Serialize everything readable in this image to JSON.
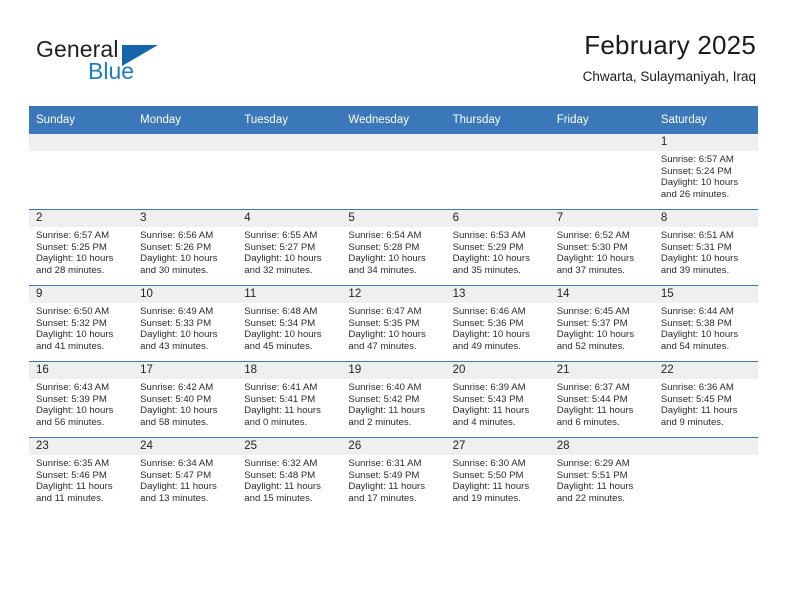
{
  "brand": {
    "name_part1": "General",
    "name_part2": "Blue",
    "triangle_color": "#1565ab",
    "blue_color": "#1f7dc2"
  },
  "header": {
    "title": "February 2025",
    "subtitle": "Chwarta, Sulaymaniyah, Iraq"
  },
  "theme": {
    "header_blue": "#3b78b9",
    "daynum_band": "#efefef",
    "text": "#2b2b2b"
  },
  "weekday_headers": [
    "Sunday",
    "Monday",
    "Tuesday",
    "Wednesday",
    "Thursday",
    "Friday",
    "Saturday"
  ],
  "labels": {
    "sunrise_prefix": "Sunrise:",
    "sunset_prefix": "Sunset:",
    "daylight_prefix": "Daylight:"
  },
  "weeks": [
    [
      {
        "day": "",
        "sunrise": "",
        "sunset": "",
        "daylight_a": "",
        "daylight_b": "",
        "empty": true
      },
      {
        "day": "",
        "sunrise": "",
        "sunset": "",
        "daylight_a": "",
        "daylight_b": "",
        "empty": true
      },
      {
        "day": "",
        "sunrise": "",
        "sunset": "",
        "daylight_a": "",
        "daylight_b": "",
        "empty": true
      },
      {
        "day": "",
        "sunrise": "",
        "sunset": "",
        "daylight_a": "",
        "daylight_b": "",
        "empty": true
      },
      {
        "day": "",
        "sunrise": "",
        "sunset": "",
        "daylight_a": "",
        "daylight_b": "",
        "empty": true
      },
      {
        "day": "",
        "sunrise": "",
        "sunset": "",
        "daylight_a": "",
        "daylight_b": "",
        "empty": true
      },
      {
        "day": "1",
        "sunrise": "Sunrise: 6:57 AM",
        "sunset": "Sunset: 5:24 PM",
        "daylight_a": "Daylight: 10 hours",
        "daylight_b": "and 26 minutes.",
        "empty": false
      }
    ],
    [
      {
        "day": "2",
        "sunrise": "Sunrise: 6:57 AM",
        "sunset": "Sunset: 5:25 PM",
        "daylight_a": "Daylight: 10 hours",
        "daylight_b": "and 28 minutes.",
        "empty": false
      },
      {
        "day": "3",
        "sunrise": "Sunrise: 6:56 AM",
        "sunset": "Sunset: 5:26 PM",
        "daylight_a": "Daylight: 10 hours",
        "daylight_b": "and 30 minutes.",
        "empty": false
      },
      {
        "day": "4",
        "sunrise": "Sunrise: 6:55 AM",
        "sunset": "Sunset: 5:27 PM",
        "daylight_a": "Daylight: 10 hours",
        "daylight_b": "and 32 minutes.",
        "empty": false
      },
      {
        "day": "5",
        "sunrise": "Sunrise: 6:54 AM",
        "sunset": "Sunset: 5:28 PM",
        "daylight_a": "Daylight: 10 hours",
        "daylight_b": "and 34 minutes.",
        "empty": false
      },
      {
        "day": "6",
        "sunrise": "Sunrise: 6:53 AM",
        "sunset": "Sunset: 5:29 PM",
        "daylight_a": "Daylight: 10 hours",
        "daylight_b": "and 35 minutes.",
        "empty": false
      },
      {
        "day": "7",
        "sunrise": "Sunrise: 6:52 AM",
        "sunset": "Sunset: 5:30 PM",
        "daylight_a": "Daylight: 10 hours",
        "daylight_b": "and 37 minutes.",
        "empty": false
      },
      {
        "day": "8",
        "sunrise": "Sunrise: 6:51 AM",
        "sunset": "Sunset: 5:31 PM",
        "daylight_a": "Daylight: 10 hours",
        "daylight_b": "and 39 minutes.",
        "empty": false
      }
    ],
    [
      {
        "day": "9",
        "sunrise": "Sunrise: 6:50 AM",
        "sunset": "Sunset: 5:32 PM",
        "daylight_a": "Daylight: 10 hours",
        "daylight_b": "and 41 minutes.",
        "empty": false
      },
      {
        "day": "10",
        "sunrise": "Sunrise: 6:49 AM",
        "sunset": "Sunset: 5:33 PM",
        "daylight_a": "Daylight: 10 hours",
        "daylight_b": "and 43 minutes.",
        "empty": false
      },
      {
        "day": "11",
        "sunrise": "Sunrise: 6:48 AM",
        "sunset": "Sunset: 5:34 PM",
        "daylight_a": "Daylight: 10 hours",
        "daylight_b": "and 45 minutes.",
        "empty": false
      },
      {
        "day": "12",
        "sunrise": "Sunrise: 6:47 AM",
        "sunset": "Sunset: 5:35 PM",
        "daylight_a": "Daylight: 10 hours",
        "daylight_b": "and 47 minutes.",
        "empty": false
      },
      {
        "day": "13",
        "sunrise": "Sunrise: 6:46 AM",
        "sunset": "Sunset: 5:36 PM",
        "daylight_a": "Daylight: 10 hours",
        "daylight_b": "and 49 minutes.",
        "empty": false
      },
      {
        "day": "14",
        "sunrise": "Sunrise: 6:45 AM",
        "sunset": "Sunset: 5:37 PM",
        "daylight_a": "Daylight: 10 hours",
        "daylight_b": "and 52 minutes.",
        "empty": false
      },
      {
        "day": "15",
        "sunrise": "Sunrise: 6:44 AM",
        "sunset": "Sunset: 5:38 PM",
        "daylight_a": "Daylight: 10 hours",
        "daylight_b": "and 54 minutes.",
        "empty": false
      }
    ],
    [
      {
        "day": "16",
        "sunrise": "Sunrise: 6:43 AM",
        "sunset": "Sunset: 5:39 PM",
        "daylight_a": "Daylight: 10 hours",
        "daylight_b": "and 56 minutes.",
        "empty": false
      },
      {
        "day": "17",
        "sunrise": "Sunrise: 6:42 AM",
        "sunset": "Sunset: 5:40 PM",
        "daylight_a": "Daylight: 10 hours",
        "daylight_b": "and 58 minutes.",
        "empty": false
      },
      {
        "day": "18",
        "sunrise": "Sunrise: 6:41 AM",
        "sunset": "Sunset: 5:41 PM",
        "daylight_a": "Daylight: 11 hours",
        "daylight_b": "and 0 minutes.",
        "empty": false
      },
      {
        "day": "19",
        "sunrise": "Sunrise: 6:40 AM",
        "sunset": "Sunset: 5:42 PM",
        "daylight_a": "Daylight: 11 hours",
        "daylight_b": "and 2 minutes.",
        "empty": false
      },
      {
        "day": "20",
        "sunrise": "Sunrise: 6:39 AM",
        "sunset": "Sunset: 5:43 PM",
        "daylight_a": "Daylight: 11 hours",
        "daylight_b": "and 4 minutes.",
        "empty": false
      },
      {
        "day": "21",
        "sunrise": "Sunrise: 6:37 AM",
        "sunset": "Sunset: 5:44 PM",
        "daylight_a": "Daylight: 11 hours",
        "daylight_b": "and 6 minutes.",
        "empty": false
      },
      {
        "day": "22",
        "sunrise": "Sunrise: 6:36 AM",
        "sunset": "Sunset: 5:45 PM",
        "daylight_a": "Daylight: 11 hours",
        "daylight_b": "and 9 minutes.",
        "empty": false
      }
    ],
    [
      {
        "day": "23",
        "sunrise": "Sunrise: 6:35 AM",
        "sunset": "Sunset: 5:46 PM",
        "daylight_a": "Daylight: 11 hours",
        "daylight_b": "and 11 minutes.",
        "empty": false
      },
      {
        "day": "24",
        "sunrise": "Sunrise: 6:34 AM",
        "sunset": "Sunset: 5:47 PM",
        "daylight_a": "Daylight: 11 hours",
        "daylight_b": "and 13 minutes.",
        "empty": false
      },
      {
        "day": "25",
        "sunrise": "Sunrise: 6:32 AM",
        "sunset": "Sunset: 5:48 PM",
        "daylight_a": "Daylight: 11 hours",
        "daylight_b": "and 15 minutes.",
        "empty": false
      },
      {
        "day": "26",
        "sunrise": "Sunrise: 6:31 AM",
        "sunset": "Sunset: 5:49 PM",
        "daylight_a": "Daylight: 11 hours",
        "daylight_b": "and 17 minutes.",
        "empty": false
      },
      {
        "day": "27",
        "sunrise": "Sunrise: 6:30 AM",
        "sunset": "Sunset: 5:50 PM",
        "daylight_a": "Daylight: 11 hours",
        "daylight_b": "and 19 minutes.",
        "empty": false
      },
      {
        "day": "28",
        "sunrise": "Sunrise: 6:29 AM",
        "sunset": "Sunset: 5:51 PM",
        "daylight_a": "Daylight: 11 hours",
        "daylight_b": "and 22 minutes.",
        "empty": false
      },
      {
        "day": "",
        "sunrise": "",
        "sunset": "",
        "daylight_a": "",
        "daylight_b": "",
        "empty": true
      }
    ]
  ]
}
